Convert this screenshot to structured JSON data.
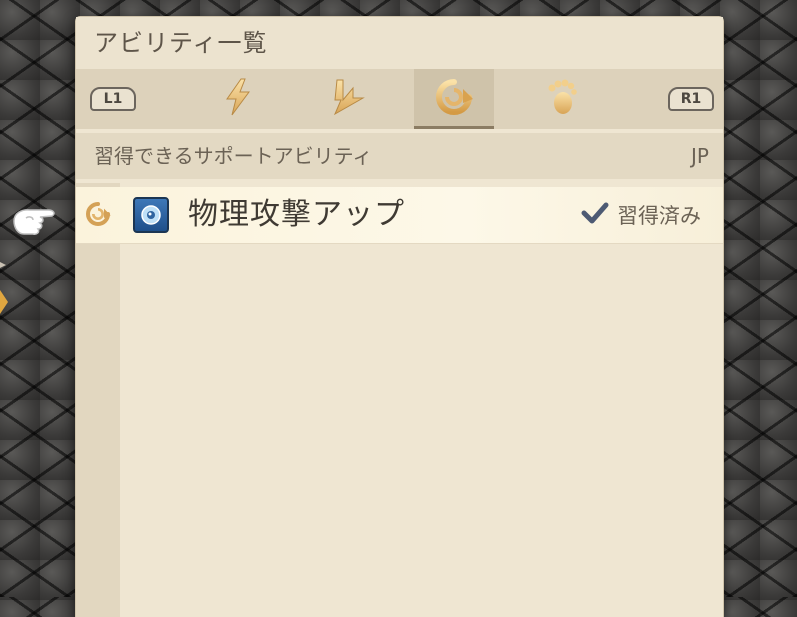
{
  "window": {
    "title": "アビリティ一覧"
  },
  "tabs": {
    "left_key": "L1",
    "right_key": "R1",
    "items": [
      {
        "icon": "lightning-icon",
        "active": false
      },
      {
        "icon": "reaction-bolt-icon",
        "active": false
      },
      {
        "icon": "support-cycle-icon",
        "active": true
      },
      {
        "icon": "footprint-icon",
        "active": false
      }
    ]
  },
  "list": {
    "header_label": "習得できるサポートアビリティ",
    "header_jp": "JP",
    "rows": [
      {
        "type_icon": "support-cycle-icon",
        "ability_icon": "shield-orb-icon",
        "name": "物理攻撃アップ",
        "status": "習得済み",
        "status_icon": "checkmark-icon"
      }
    ]
  },
  "colors": {
    "panel_bg": "#efe6d2",
    "tab_active": "#cfc3aa",
    "check": "#4d5a73"
  }
}
